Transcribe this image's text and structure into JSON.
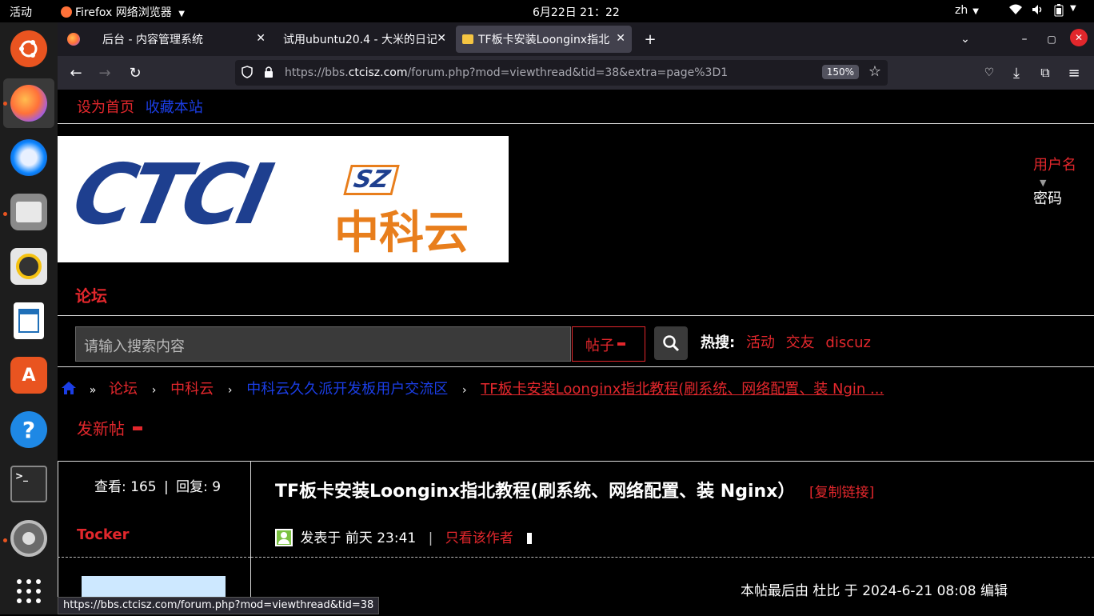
{
  "topbar": {
    "activities": "活动",
    "app_name": "Firefox 网络浏览器",
    "datetime": "6月22日  21：22",
    "input_method": "zh"
  },
  "tabs": [
    {
      "title": "后台 - 内容管理系统"
    },
    {
      "title": "试用ubuntu20.4 - 大米的日记"
    },
    {
      "title": "TF板卡安装Loonginx指北"
    }
  ],
  "nav": {
    "url_host_prefix": "https://bbs.",
    "url_host": "ctcisz.com",
    "url_path": "/forum.php?mod=viewthread&tid=38&extra=page%3D1",
    "zoom": "150%"
  },
  "site": {
    "set_homepage": "设为首页",
    "bookmark": "收藏本站",
    "logo_latin": "CTCI",
    "logo_sz": "SZ",
    "logo_cn": "中科云",
    "username_label": "用户名",
    "password_label": "密码",
    "forum_nav": "论坛",
    "search_placeholder": "请输入搜索内容",
    "search_type": "帖子",
    "hot_label": "热搜:",
    "hot_items": [
      "活动",
      "交友",
      "discuz"
    ]
  },
  "breadcrumb": {
    "items": [
      "论坛",
      "中科云",
      "中科云久久派开发板用户交流区",
      "TF板卡安装Loonginx指北教程(刷系统、网络配置、装 Ngin ..."
    ]
  },
  "new_post": "发新帖",
  "thread": {
    "views_label": "查看:",
    "views": "165",
    "replies_label": "回复:",
    "replies": "9",
    "author": "Tocker",
    "title": "TF板卡安装Loonginx指北教程(刷系统、网络配置、装 Nginx）",
    "copy_link": "[复制链接]",
    "posted_label": "发表于",
    "posted_time": "前天 23:41",
    "only_author": "只看该作者",
    "edit_note": "本帖最后由 杜比 于 2024-6-21 08:08 编辑"
  },
  "status_url": "https://bbs.ctcisz.com/forum.php?mod=viewthread&tid=38"
}
